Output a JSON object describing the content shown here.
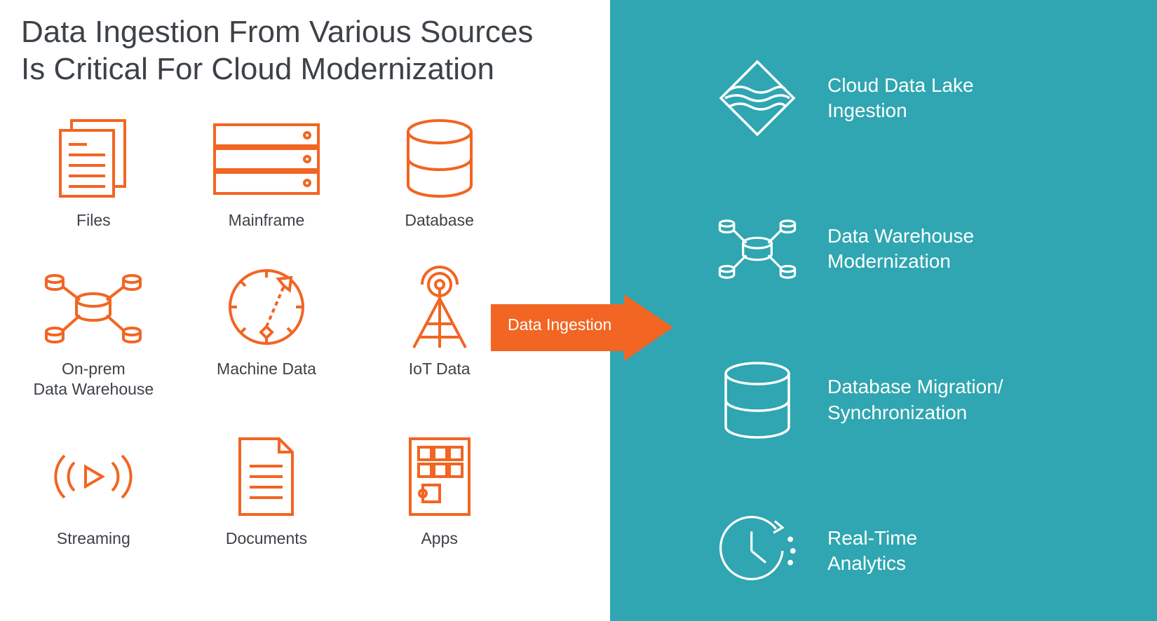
{
  "title_line1": "Data Ingestion From Various Sources",
  "title_line2": "Is Critical For Cloud Modernization",
  "arrow_label": "Data Ingestion",
  "colors": {
    "orange": "#F26522",
    "teal": "#2FA6B1",
    "white": "#FFFFFF",
    "text_dark": "#3D4248"
  },
  "sources": [
    {
      "id": "files",
      "label": "Files"
    },
    {
      "id": "mainframe",
      "label": "Mainframe"
    },
    {
      "id": "database",
      "label": "Database"
    },
    {
      "id": "onprem-dw",
      "label": "On-prem\nData Warehouse"
    },
    {
      "id": "machine-data",
      "label": "Machine Data"
    },
    {
      "id": "iot-data",
      "label": "IoT Data"
    },
    {
      "id": "streaming",
      "label": "Streaming"
    },
    {
      "id": "documents",
      "label": "Documents"
    },
    {
      "id": "apps",
      "label": "Apps"
    }
  ],
  "targets": [
    {
      "id": "cloud-data-lake",
      "label": "Cloud Data Lake\nIngestion"
    },
    {
      "id": "dw-modernization",
      "label": "Data Warehouse\nModernization"
    },
    {
      "id": "db-migration",
      "label": "Database Migration/\nSynchronization"
    },
    {
      "id": "realtime-analytics",
      "label": "Real-Time\nAnalytics"
    }
  ]
}
